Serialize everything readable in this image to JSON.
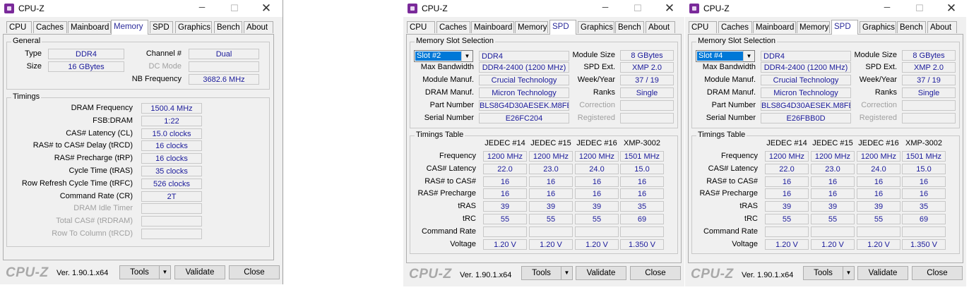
{
  "app": {
    "title": "CPU-Z",
    "min_glyph": "─",
    "max_glyph": "☐",
    "close_glyph": "✕",
    "logo_text": "CPU-Z",
    "version": "Ver. 1.90.1.x64",
    "tools_label": "Tools",
    "dropdown_glyph": "▼",
    "validate_label": "Validate",
    "close_label": "Close"
  },
  "tabs": [
    "CPU",
    "Caches",
    "Mainboard",
    "Memory",
    "SPD",
    "Graphics",
    "Bench",
    "About"
  ],
  "memory": {
    "general_title": "General",
    "type_label": "Type",
    "type_value": "DDR4",
    "size_label": "Size",
    "size_value": "16 GBytes",
    "channel_label": "Channel #",
    "channel_value": "Dual",
    "dc_mode_label": "DC Mode",
    "dc_mode_value": "",
    "nb_freq_label": "NB Frequency",
    "nb_freq_value": "3682.6 MHz",
    "timings_title": "Timings",
    "timings": [
      {
        "label": "DRAM Frequency",
        "value": "1500.4 MHz",
        "dim": false
      },
      {
        "label": "FSB:DRAM",
        "value": "1:22",
        "dim": false
      },
      {
        "label": "CAS# Latency (CL)",
        "value": "15.0 clocks",
        "dim": false
      },
      {
        "label": "RAS# to CAS# Delay (tRCD)",
        "value": "16 clocks",
        "dim": false
      },
      {
        "label": "RAS# Precharge (tRP)",
        "value": "16 clocks",
        "dim": false
      },
      {
        "label": "Cycle Time (tRAS)",
        "value": "35 clocks",
        "dim": false
      },
      {
        "label": "Row Refresh Cycle Time (tRFC)",
        "value": "526 clocks",
        "dim": false
      },
      {
        "label": "Command Rate (CR)",
        "value": "2T",
        "dim": false
      },
      {
        "label": "DRAM Idle Timer",
        "value": "",
        "dim": true
      },
      {
        "label": "Total CAS# (tRDRAM)",
        "value": "",
        "dim": true
      },
      {
        "label": "Row To Column (tRCD)",
        "value": "",
        "dim": true
      }
    ]
  },
  "spd_labels": {
    "slot_group_title": "Memory Slot Selection",
    "max_bandwidth": "Max Bandwidth",
    "module_manuf": "Module Manuf.",
    "dram_manuf": "DRAM Manuf.",
    "part_number": "Part Number",
    "serial_number": "Serial Number",
    "module_size": "Module Size",
    "spd_ext": "SPD Ext.",
    "week_year": "Week/Year",
    "ranks": "Ranks",
    "correction": "Correction",
    "registered": "Registered",
    "timings_title": "Timings Table",
    "columns": [
      "JEDEC #14",
      "JEDEC #15",
      "JEDEC #16",
      "XMP-3002"
    ],
    "row_labels": [
      "Frequency",
      "CAS# Latency",
      "RAS# to CAS#",
      "RAS# Precharge",
      "tRAS",
      "tRC",
      "Command Rate",
      "Voltage"
    ]
  },
  "spd_windows": [
    {
      "slot": "Slot #2",
      "module_type": "DDR4",
      "max_bandwidth": "DDR4-2400 (1200 MHz)",
      "module_manuf": "Crucial Technology",
      "dram_manuf": "Micron Technology",
      "part_number": "BLS8G4D30AESEK.M8FE",
      "serial_number": "E26FC204",
      "module_size": "8 GBytes",
      "spd_ext": "XMP 2.0",
      "week_year": "37 / 19",
      "ranks": "Single",
      "timing_rows": [
        [
          "1200 MHz",
          "1200 MHz",
          "1200 MHz",
          "1501 MHz"
        ],
        [
          "22.0",
          "23.0",
          "24.0",
          "15.0"
        ],
        [
          "16",
          "16",
          "16",
          "16"
        ],
        [
          "16",
          "16",
          "16",
          "16"
        ],
        [
          "39",
          "39",
          "39",
          "35"
        ],
        [
          "55",
          "55",
          "55",
          "69"
        ],
        [
          "",
          "",
          "",
          ""
        ],
        [
          "1.20 V",
          "1.20 V",
          "1.20 V",
          "1.350 V"
        ]
      ]
    },
    {
      "slot": "Slot #4",
      "module_type": "DDR4",
      "max_bandwidth": "DDR4-2400 (1200 MHz)",
      "module_manuf": "Crucial Technology",
      "dram_manuf": "Micron Technology",
      "part_number": "BLS8G4D30AESEK.M8FE",
      "serial_number": "E26FBB0D",
      "module_size": "8 GBytes",
      "spd_ext": "XMP 2.0",
      "week_year": "37 / 19",
      "ranks": "Single",
      "timing_rows": [
        [
          "1200 MHz",
          "1200 MHz",
          "1200 MHz",
          "1501 MHz"
        ],
        [
          "22.0",
          "23.0",
          "24.0",
          "15.0"
        ],
        [
          "16",
          "16",
          "16",
          "16"
        ],
        [
          "16",
          "16",
          "16",
          "16"
        ],
        [
          "39",
          "39",
          "39",
          "35"
        ],
        [
          "55",
          "55",
          "55",
          "69"
        ],
        [
          "",
          "",
          "",
          ""
        ],
        [
          "1.20 V",
          "1.20 V",
          "1.20 V",
          "1.350 V"
        ]
      ]
    }
  ]
}
